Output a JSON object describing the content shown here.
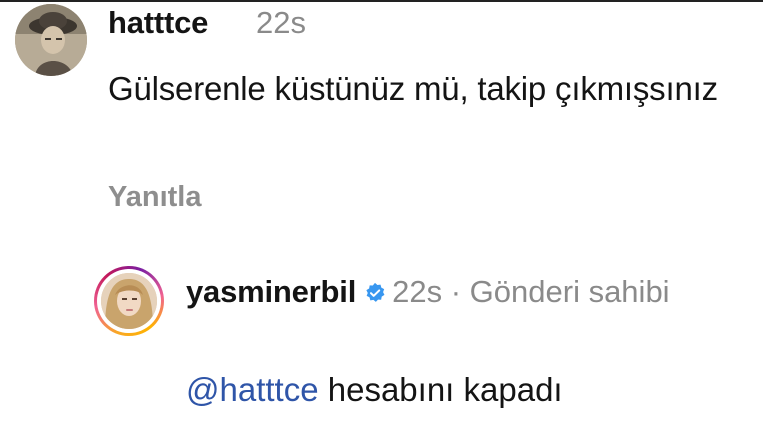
{
  "comment": {
    "username": "hatttce",
    "time": "22s",
    "text": "Gülserenle küstünüz mü, takip çıkmışsınız",
    "reply_label": "Yanıtla",
    "avatar_icon": "profile-photo-hatttce"
  },
  "reply": {
    "username": "yasminerbil",
    "verified_icon": "verified-badge-icon",
    "time": "22s",
    "separator": "·",
    "owner_label": "Gönderi sahibi",
    "mention": "@hatttce",
    "text": " hesabını kapadı",
    "avatar_icon": "profile-photo-yasminerbil"
  },
  "colors": {
    "text": "#141414",
    "muted": "#8a8a8a",
    "mention": "#2f55a8",
    "verified": "#3897f0"
  }
}
